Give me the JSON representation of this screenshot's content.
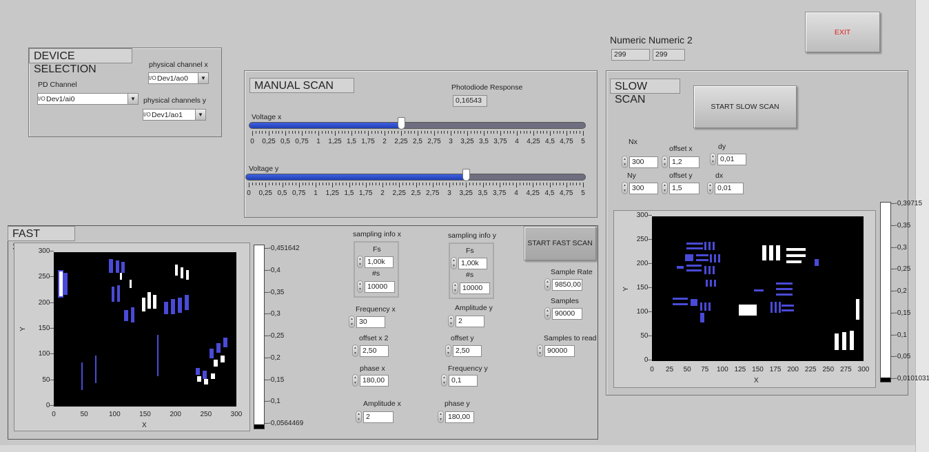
{
  "exit_label": "EXIT",
  "numerics": {
    "label": "Numeric Numeric 2",
    "numeric1": "299",
    "numeric2": "299"
  },
  "device_selection": {
    "title": "DEVICE SELECTION",
    "pd_channel_label": "PD Channel",
    "pd_channel_value": "Dev1/ai0",
    "phys_x_label": "physical channel x",
    "phys_x_value": "Dev1/ao0",
    "phys_y_label": "physical channels y",
    "phys_y_value": "Dev1/ao1"
  },
  "manual_scan": {
    "title": "MANUAL SCAN",
    "pd_response_label": "Photodiode Response",
    "pd_response_value": "0,16543",
    "voltage_x_label": "Voltage x",
    "voltage_x_value": 2.25,
    "voltage_y_label": "Voltage y",
    "voltage_y_value": 3.25,
    "scale_max": 5,
    "scale_labels": [
      "0",
      "0,25",
      "0,5",
      "0,75",
      "1",
      "1,25",
      "1,5",
      "1,75",
      "2",
      "2,25",
      "2,5",
      "2,75",
      "3",
      "3,25",
      "3,5",
      "3,75",
      "4",
      "4,25",
      "4,5",
      "4,75",
      "5"
    ]
  },
  "slow_scan": {
    "title": "SLOW SCAN",
    "start_label": "START SLOW SCAN",
    "nx_label": "Nx",
    "nx_value": "300",
    "ny_label": "Ny",
    "ny_value": "300",
    "offset_x_label": "offset x",
    "offset_x_value": "1,2",
    "offset_y_label": "offset y",
    "offset_y_value": "1,5",
    "dy_label": "dy",
    "dy_value": "0,01",
    "dx_label": "dx",
    "dx_value": "0,01",
    "graph": {
      "x_label": "X",
      "y_label": "Y",
      "x_ticks": [
        "0",
        "25",
        "50",
        "75",
        "100",
        "125",
        "150",
        "175",
        "200",
        "225",
        "250",
        "275",
        "300"
      ],
      "y_ticks": [
        "300",
        "250",
        "200",
        "150",
        "100",
        "50",
        "0"
      ],
      "colorbar_ticks": [
        "-0,39715",
        "-0,35",
        "-0,3",
        "-0,25",
        "-0,2",
        "-0,15",
        "-0,1",
        "-0,05",
        "-0,0101031"
      ]
    }
  },
  "fast_scan": {
    "title": "FAST SCAN",
    "start_label": "START FAST SCAN",
    "sampling_x_label": "sampling info x",
    "sampling_y_label": "sampling info y",
    "fs_label": "Fs",
    "ns_label": "#s",
    "fs_x_value": "1,00k",
    "ns_x_value": "10000",
    "fs_y_value": "1,00k",
    "ns_y_value": "10000",
    "sample_rate_label": "Sample Rate",
    "sample_rate_value": "9850,00",
    "samples_label": "Samples",
    "samples_value": "90000",
    "samples_to_read_label": "Samples to read",
    "samples_to_read_value": "90000",
    "frequency_x_label": "Frequency x",
    "frequency_x_value": "30",
    "amplitude_y_label": "Amplitude y",
    "amplitude_y_value": "2",
    "offset_x2_label": "offset x 2",
    "offset_x2_value": "2,50",
    "offset_y_label": "offset y",
    "offset_y_value": "2,50",
    "phase_x_label": "phase x",
    "phase_x_value": "180,00",
    "frequency_y_label": "Frequency y",
    "frequency_y_value": "0,1",
    "amplitude_x_label": "Amplitude x",
    "amplitude_x_value": "2",
    "phase_y_label": "phase y",
    "phase_y_value": "180,00",
    "graph": {
      "x_label": "X",
      "y_label": "Y",
      "x_ticks": [
        "0",
        "50",
        "100",
        "150",
        "200",
        "250",
        "300"
      ],
      "y_ticks": [
        "300",
        "250",
        "200",
        "150",
        "100",
        "50",
        "0"
      ],
      "colorbar_ticks": [
        "-0,451642",
        "-0,4",
        "-0,35",
        "-0,3",
        "-0,25",
        "-0,2",
        "-0,15",
        "-0,1",
        "-0,0564469"
      ]
    }
  },
  "colors": {
    "panel": "#c8c8c8",
    "slider_fill": "#2f4fcf",
    "plot_bg": "#000000",
    "exit_text": "#e02020"
  }
}
